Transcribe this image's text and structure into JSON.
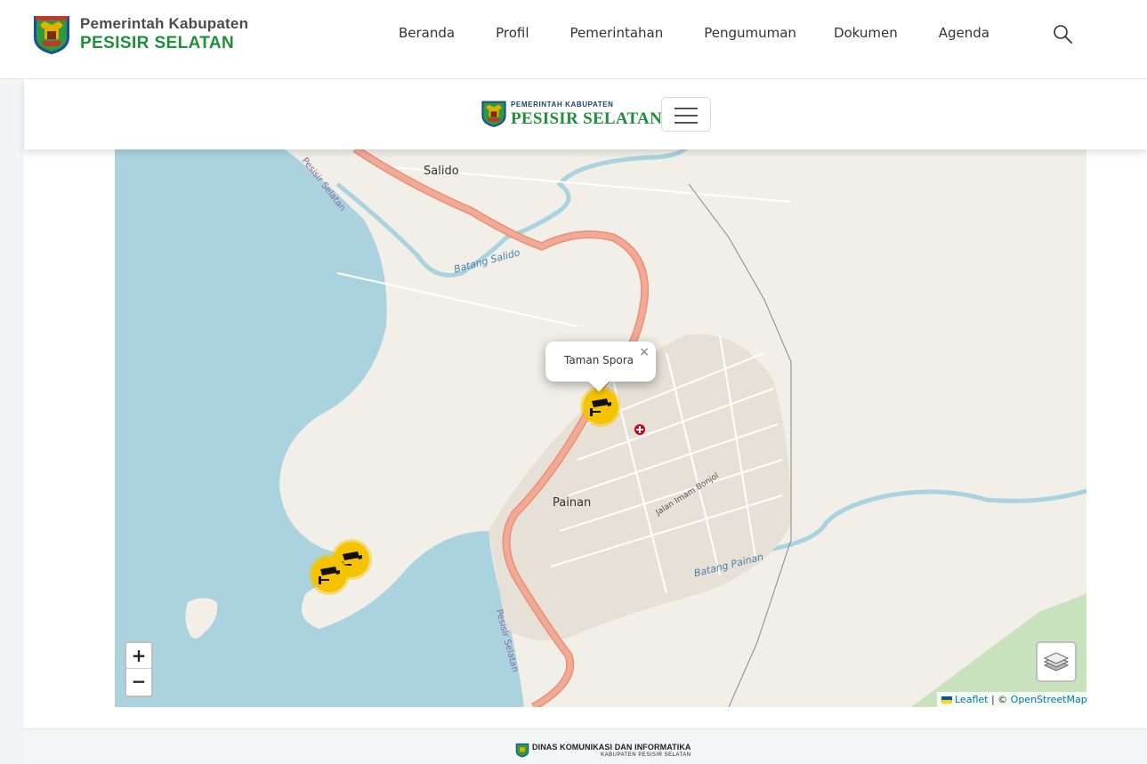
{
  "header": {
    "logo_line1": "Pemerintah  Kabupaten",
    "logo_line2": "PESISIR SELATAN",
    "nav": [
      "Beranda",
      "Profil",
      "Pemerintahan",
      "Pengumuman",
      "Dokumen",
      "Agenda"
    ]
  },
  "subheader": {
    "logo_line1": "PEMERINTAH KABUPATEN",
    "logo_line2": "PESISIR SELATAN"
  },
  "map": {
    "popup_text": "Taman Spora",
    "popup_close": "×",
    "zoom_in": "+",
    "zoom_out": "−",
    "attribution_leaflet": "Leaflet",
    "attribution_sep": "| ©",
    "attribution_osm": "OpenStreetMap",
    "labels": {
      "town_salido": "Salido",
      "town_painan": "Painan",
      "river_salido": "Batang Salido",
      "river_painan": "Batang Painan",
      "road_imam_bonjol": "Jalan Imam Bonjol",
      "admin_top": "Pesisir Selatan",
      "admin_bottom": "Pesisir Selatan"
    },
    "marker_icon": "cctv-camera-icon"
  },
  "footer": {
    "line1": "DINAS KOMUNIKASI DAN INFORMATIKA",
    "line2": "KABUPATEN PESISIR SELATAN"
  }
}
